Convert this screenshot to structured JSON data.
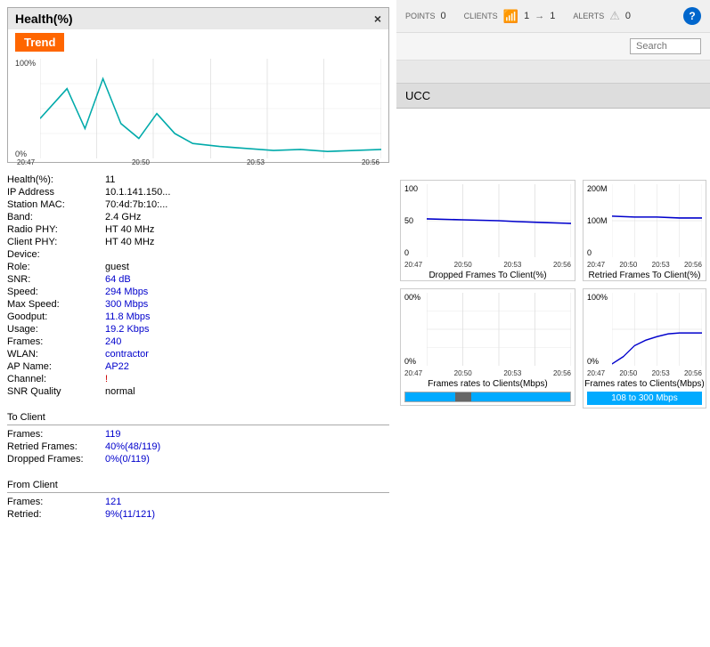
{
  "health_widget": {
    "title": "Health(%)",
    "trend_label": "Trend",
    "close": "×",
    "chart_y_max": "100%",
    "chart_y_min": "0%",
    "time_labels": [
      "20:47",
      "20:50",
      "20:53",
      "20:56"
    ]
  },
  "info": {
    "health_label": "Health(%):",
    "health_value": "11",
    "ip_label": "IP Address",
    "ip_value": "10.1.141.150...",
    "mac_label": "Station MAC:",
    "mac_value": "70:4d:7b:10:...",
    "band_label": "Band:",
    "band_value": "2.4 GHz",
    "radio_phy_label": "Radio PHY:",
    "radio_phy_value": "HT 40 MHz",
    "client_phy_label": "Client PHY:",
    "client_phy_value": "HT 40 MHz",
    "device_label": "Device:",
    "device_value": "",
    "role_label": "Role:",
    "role_value": "guest",
    "snr_label": "SNR:",
    "snr_value": "64 dB",
    "speed_label": "Speed:",
    "speed_value": "294 Mbps",
    "max_speed_label": "Max Speed:",
    "max_speed_value": "300 Mbps",
    "goodput_label": "Goodput:",
    "goodput_value": "11.8 Mbps",
    "usage_label": "Usage:",
    "usage_value": "19.2 Kbps",
    "frames_label": "Frames:",
    "frames_value": "240",
    "wlan_label": "WLAN:",
    "wlan_value": "contractor",
    "ap_name_label": "AP Name:",
    "ap_name_value": "AP22",
    "channel_label": "Channel:",
    "channel_value": "!",
    "snr_quality_label": "SNR Quality",
    "snr_quality_value": "normal"
  },
  "to_client": {
    "section_title": "To Client",
    "frames_label": "Frames:",
    "frames_value": "119",
    "retried_label": "Retried Frames:",
    "retried_value": "40%(48/119)",
    "dropped_label": "Dropped Frames:",
    "dropped_value": "0%(0/119)"
  },
  "from_client": {
    "section_title": "From Client",
    "frames_label": "Frames:",
    "frames_value": "121",
    "retried_label": "Retried:",
    "retried_value": "9%(11/121)"
  },
  "charts": {
    "dropped_title": "Dropped Frames To Client(%)",
    "retried_title": "Retried Frames To Client(%)",
    "frames_rates_title": "Frames rates to Clients(Mbps)",
    "time_labels": [
      "20:47",
      "20:50",
      "20:53",
      "20:56"
    ],
    "dropped_y_max": "100",
    "dropped_y_min": "0",
    "retried_y_max": "200M",
    "retried_y_min": "0",
    "frame_rates_y_max": "00%",
    "frame_rates_y_min": "0%",
    "color_bar_label": "108 to 300 Mbps"
  },
  "header": {
    "points_label": "POINTS",
    "points_value": "0",
    "clients_label": "CLIENTS",
    "clients_value1": "1",
    "clients_value2": "1",
    "alerts_label": "ALERTS",
    "alerts_value": "0",
    "help": "?"
  },
  "search": {
    "placeholder": "Search",
    "button_label": "Search"
  },
  "ucc": {
    "label": "UCC"
  }
}
